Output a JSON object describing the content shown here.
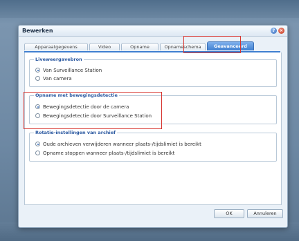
{
  "window": {
    "title": "Bewerken"
  },
  "tabs": [
    {
      "label": "Apparaatgegevens",
      "active": false
    },
    {
      "label": "Video",
      "active": false
    },
    {
      "label": "Opname",
      "active": false
    },
    {
      "label": "Opnameschema",
      "active": false
    },
    {
      "label": "Geavanceerd",
      "active": true
    }
  ],
  "groups": {
    "live_source": {
      "legend": "Liveweergavebron",
      "options": [
        {
          "label": "Van Surveillance Station",
          "checked": true
        },
        {
          "label": "Van camera",
          "checked": false
        }
      ]
    },
    "motion_recording": {
      "legend": "Opname met bewegingsdetectie",
      "options": [
        {
          "label": "Bewegingsdetectie door de camera",
          "checked": true
        },
        {
          "label": "Bewegingsdetectie door Surveillance Station",
          "checked": false
        }
      ]
    },
    "archive_rotation": {
      "legend": "Rotatie-instellingen van archief",
      "options": [
        {
          "label": "Oude archieven verwijderen wanneer plaats-/tijdslimiet is bereikt",
          "checked": true
        },
        {
          "label": "Opname stoppen wanneer plaats-/tijdslimiet is bereikt",
          "checked": false
        }
      ]
    }
  },
  "buttons": {
    "ok": "OK",
    "cancel": "Annuleren"
  },
  "colors": {
    "accent": "#3f7fd0",
    "highlight": "#d7342f"
  }
}
